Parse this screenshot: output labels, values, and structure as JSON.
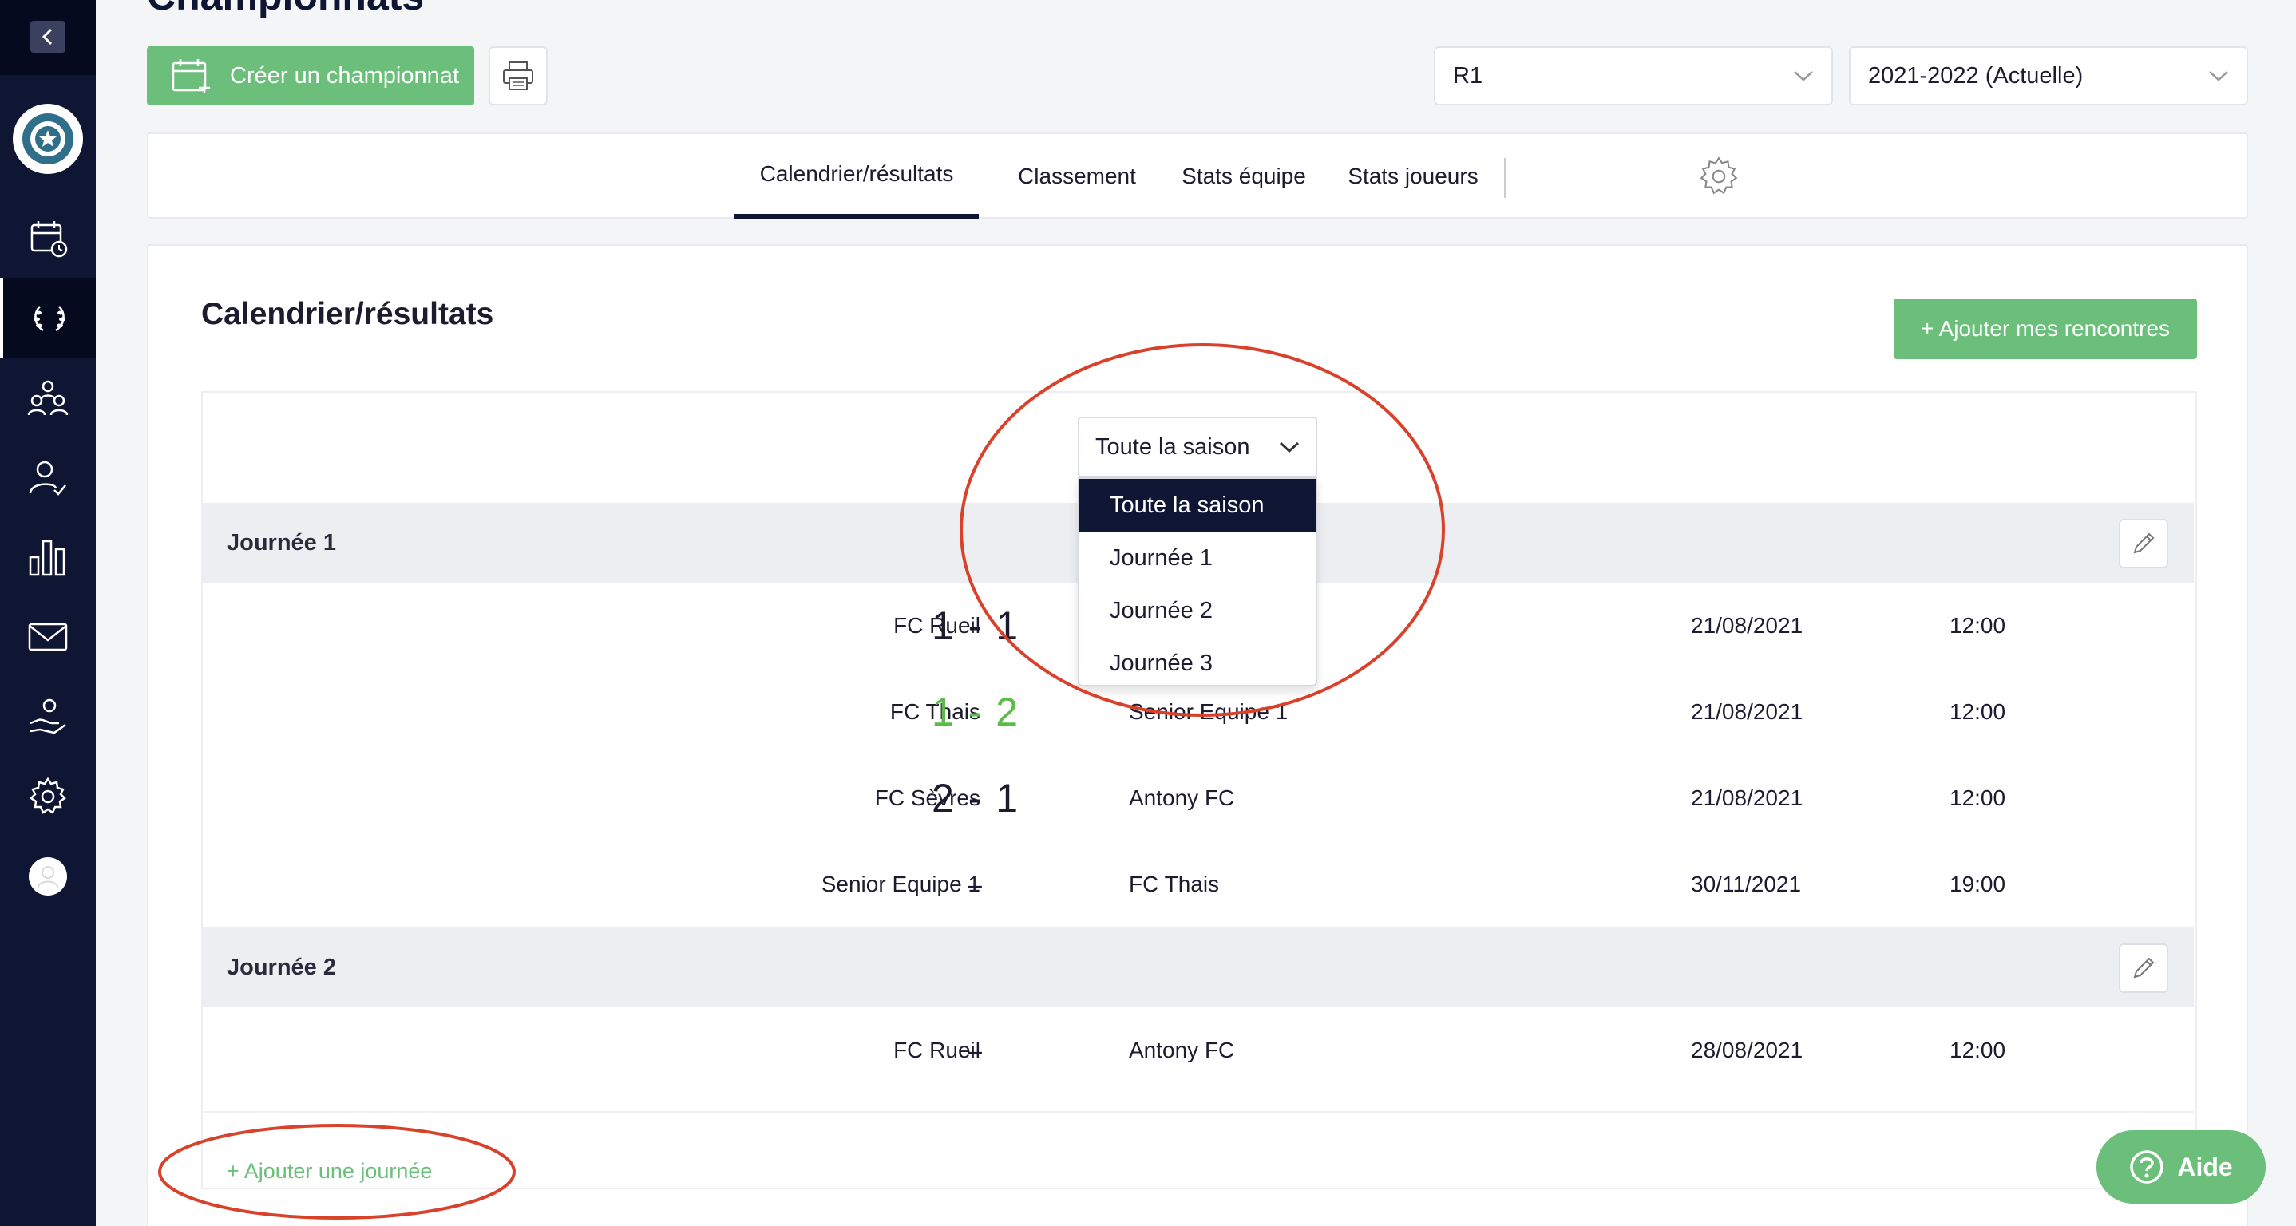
{
  "page": {
    "title": "Championnats"
  },
  "toolbar": {
    "create_label": "Créer un championnat",
    "championship_select": "R1",
    "season_select": "2021-2022 (Actuelle)"
  },
  "tabs": [
    {
      "label": "Calendrier/résultats"
    },
    {
      "label": "Classement"
    },
    {
      "label": "Stats équipe"
    },
    {
      "label": "Stats joueurs"
    }
  ],
  "content": {
    "title": "Calendrier/résultats",
    "add_matches_label": "+ Ajouter mes rencontres",
    "filter_value": "Toute la saison",
    "filter_options": [
      "Toute la saison",
      "Journée 1",
      "Journée 2",
      "Journée 3"
    ],
    "add_day_label": "+ Ajouter une journée"
  },
  "days": [
    {
      "label": "Journée 1",
      "matches": [
        {
          "home": "FC Rueil",
          "score": "1 - 1",
          "away": "",
          "date": "21/08/2021",
          "time": "12:00"
        },
        {
          "home": "FC Thais",
          "score": "1 - 2",
          "away": "Senior Equipe 1",
          "date": "21/08/2021",
          "time": "12:00"
        },
        {
          "home": "FC Sèvres",
          "score": "2 - 1",
          "away": "Antony FC",
          "date": "21/08/2021",
          "time": "12:00"
        },
        {
          "home": "Senior Equipe 1",
          "score": "–",
          "away": "FC Thais",
          "date": "30/11/2021",
          "time": "19:00"
        }
      ]
    },
    {
      "label": "Journée 2",
      "matches": [
        {
          "home": "FC Rueil",
          "score": "–",
          "away": "Antony FC",
          "date": "28/08/2021",
          "time": "12:00"
        }
      ]
    }
  ],
  "help": {
    "label": "Aide"
  },
  "colors": {
    "sidebar": "#0f1633",
    "accent_green": "#6bbf7a",
    "annotation_red": "#d9412b"
  }
}
